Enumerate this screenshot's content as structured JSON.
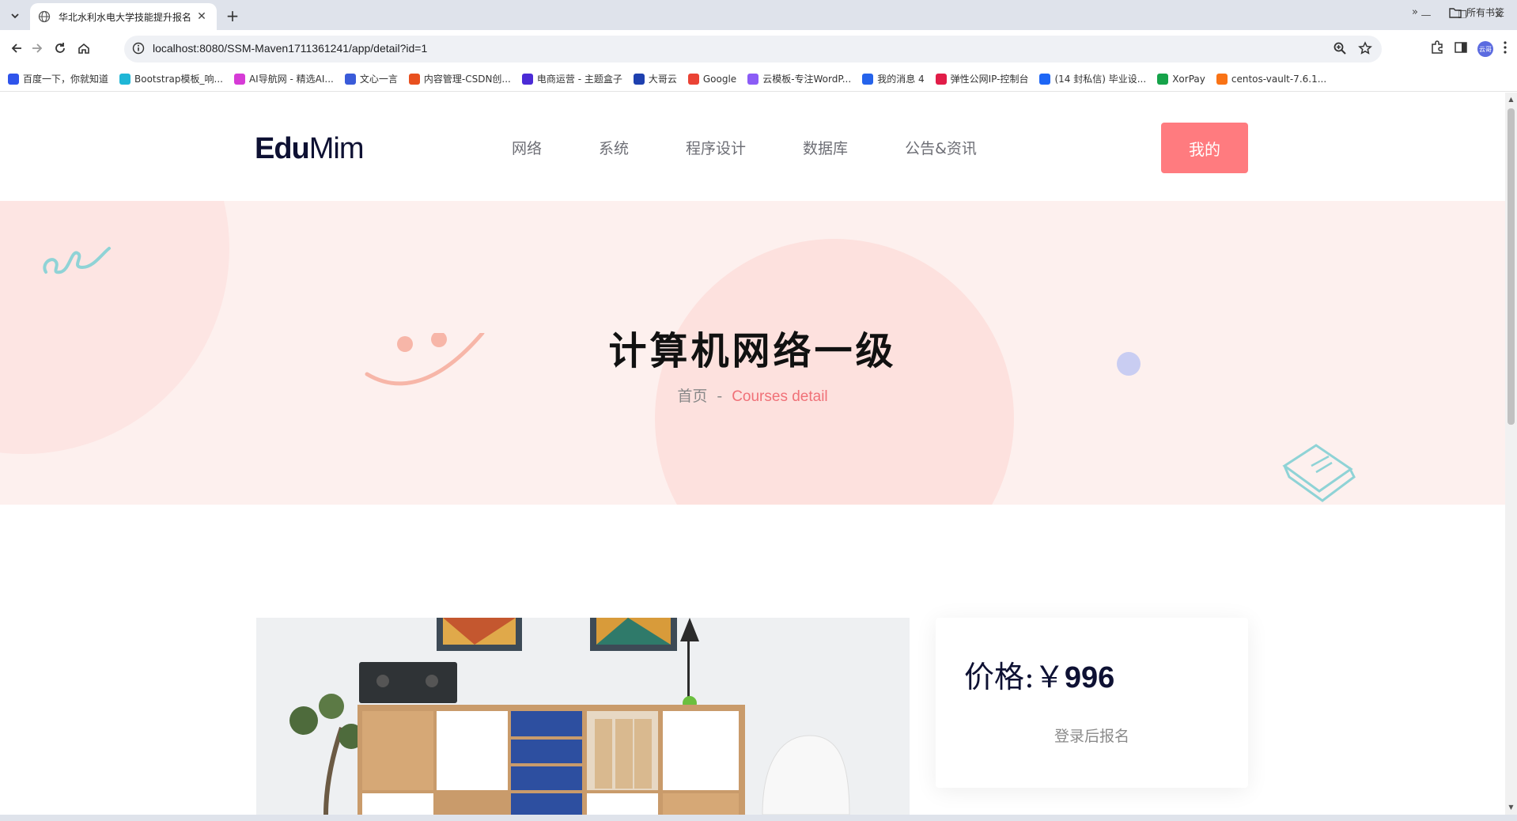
{
  "browser": {
    "tab_title": "华北水利水电大学技能提升报名",
    "url": "localhost:8080/SSM-Maven1711361241/app/detail?id=1",
    "avatar_label": "云哥",
    "bookmarks": [
      {
        "label": "百度一下，你就知道",
        "color": "#2f54eb"
      },
      {
        "label": "Bootstrap模板_响...",
        "color": "#1fb6d6"
      },
      {
        "label": "AI导航网 - 精选AI...",
        "color": "#d63bd6"
      },
      {
        "label": "文心一言",
        "color": "#3a5bd9"
      },
      {
        "label": "内容管理-CSDN创...",
        "color": "#e8501f"
      },
      {
        "label": "电商运营 - 主题盒子",
        "color": "#4b2bd6"
      },
      {
        "label": "大哥云",
        "color": "#1e40af"
      },
      {
        "label": "Google",
        "color": "#ea4335"
      },
      {
        "label": "云模板-专注WordP...",
        "color": "#8b5cf6"
      },
      {
        "label": "我的消息 4",
        "color": "#2563eb"
      },
      {
        "label": "弹性公网IP-控制台",
        "color": "#e11d48"
      },
      {
        "label": "(14 封私信) 毕业设...",
        "color": "#1e66f5"
      },
      {
        "label": "XorPay",
        "color": "#16a34a"
      },
      {
        "label": "centos-vault-7.6.1...",
        "color": "#f97316"
      }
    ],
    "more_bookmarks": "»",
    "all_bookmarks_label": "所有书签"
  },
  "header": {
    "logo_bold": "Edu",
    "logo_light": "Mim",
    "nav": [
      "网络",
      "系统",
      "程序设计",
      "数据库",
      "公告&资讯"
    ],
    "my_button": "我的"
  },
  "hero": {
    "title": "计算机网络一级",
    "breadcrumb_home": "首页",
    "breadcrumb_sep": "-",
    "breadcrumb_current": "Courses detail"
  },
  "course": {
    "price_label": "价格:￥",
    "price_value": "996",
    "enroll_text": "登录后报名"
  },
  "colors": {
    "accent": "#ff7b7f",
    "hero_bg": "#fdf0ee",
    "heading": "#0e1133"
  }
}
